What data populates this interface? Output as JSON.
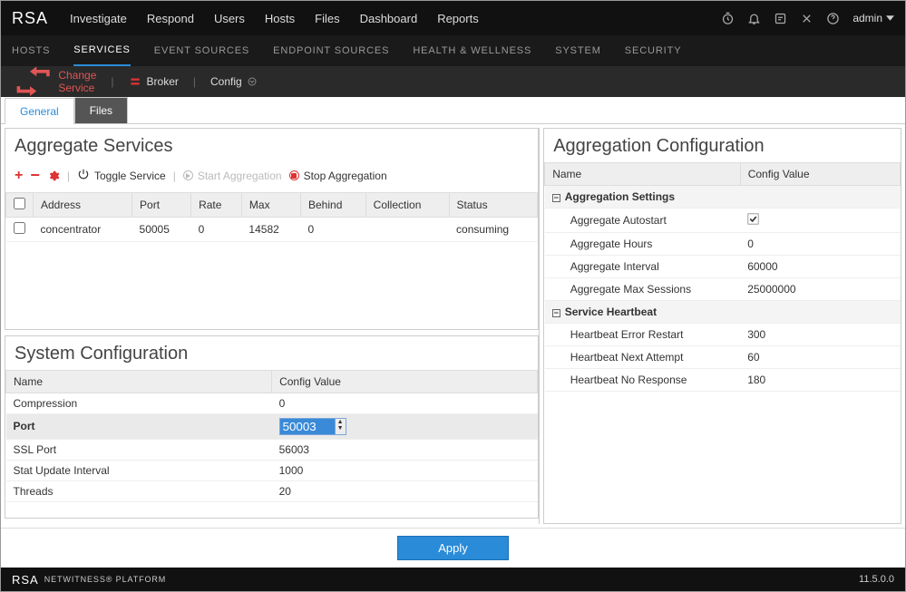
{
  "brand": "RSA",
  "topnav": [
    "Investigate",
    "Respond",
    "Users",
    "Hosts",
    "Files",
    "Dashboard",
    "Reports"
  ],
  "admin_label": "admin",
  "subnav": {
    "items": [
      "HOSTS",
      "SERVICES",
      "EVENT SOURCES",
      "ENDPOINT SOURCES",
      "HEALTH & WELLNESS",
      "SYSTEM",
      "SECURITY"
    ],
    "active": 1
  },
  "crumb": {
    "change_service": "Change Service",
    "broker": "Broker",
    "config": "Config"
  },
  "tabs": {
    "general": "General",
    "files": "Files"
  },
  "agg_services": {
    "title": "Aggregate Services",
    "toolbar": {
      "toggle_service": "Toggle Service",
      "start_agg": "Start Aggregation",
      "stop_agg": "Stop Aggregation"
    },
    "columns": [
      "Address",
      "Port",
      "Rate",
      "Max",
      "Behind",
      "Collection",
      "Status"
    ],
    "rows": [
      {
        "address": "concentrator",
        "port": "50005",
        "rate": "0",
        "max": "14582",
        "behind": "0",
        "collection": "",
        "status": "consuming"
      }
    ]
  },
  "sys_cfg": {
    "title": "System Configuration",
    "name_hdr": "Name",
    "value_hdr": "Config Value",
    "rows": [
      {
        "name": "Compression",
        "value": "0"
      },
      {
        "name": "Port",
        "value": "50003",
        "editing": true
      },
      {
        "name": "SSL Port",
        "value": "56003"
      },
      {
        "name": "Stat Update Interval",
        "value": "1000"
      },
      {
        "name": "Threads",
        "value": "20"
      }
    ]
  },
  "agg_cfg": {
    "title": "Aggregation Configuration",
    "name_hdr": "Name",
    "value_hdr": "Config Value",
    "groups": [
      {
        "label": "Aggregation Settings",
        "rows": [
          {
            "name": "Aggregate Autostart",
            "value_type": "checkbox",
            "checked": true
          },
          {
            "name": "Aggregate Hours",
            "value": "0"
          },
          {
            "name": "Aggregate Interval",
            "value": "60000"
          },
          {
            "name": "Aggregate Max Sessions",
            "value": "25000000"
          }
        ]
      },
      {
        "label": "Service Heartbeat",
        "rows": [
          {
            "name": "Heartbeat Error Restart",
            "value": "300"
          },
          {
            "name": "Heartbeat Next Attempt",
            "value": "60"
          },
          {
            "name": "Heartbeat No Response",
            "value": "180"
          }
        ]
      }
    ]
  },
  "apply_label": "Apply",
  "footer": {
    "brand": "RSA",
    "product": "NETWITNESS® PLATFORM",
    "version": "11.5.0.0"
  }
}
